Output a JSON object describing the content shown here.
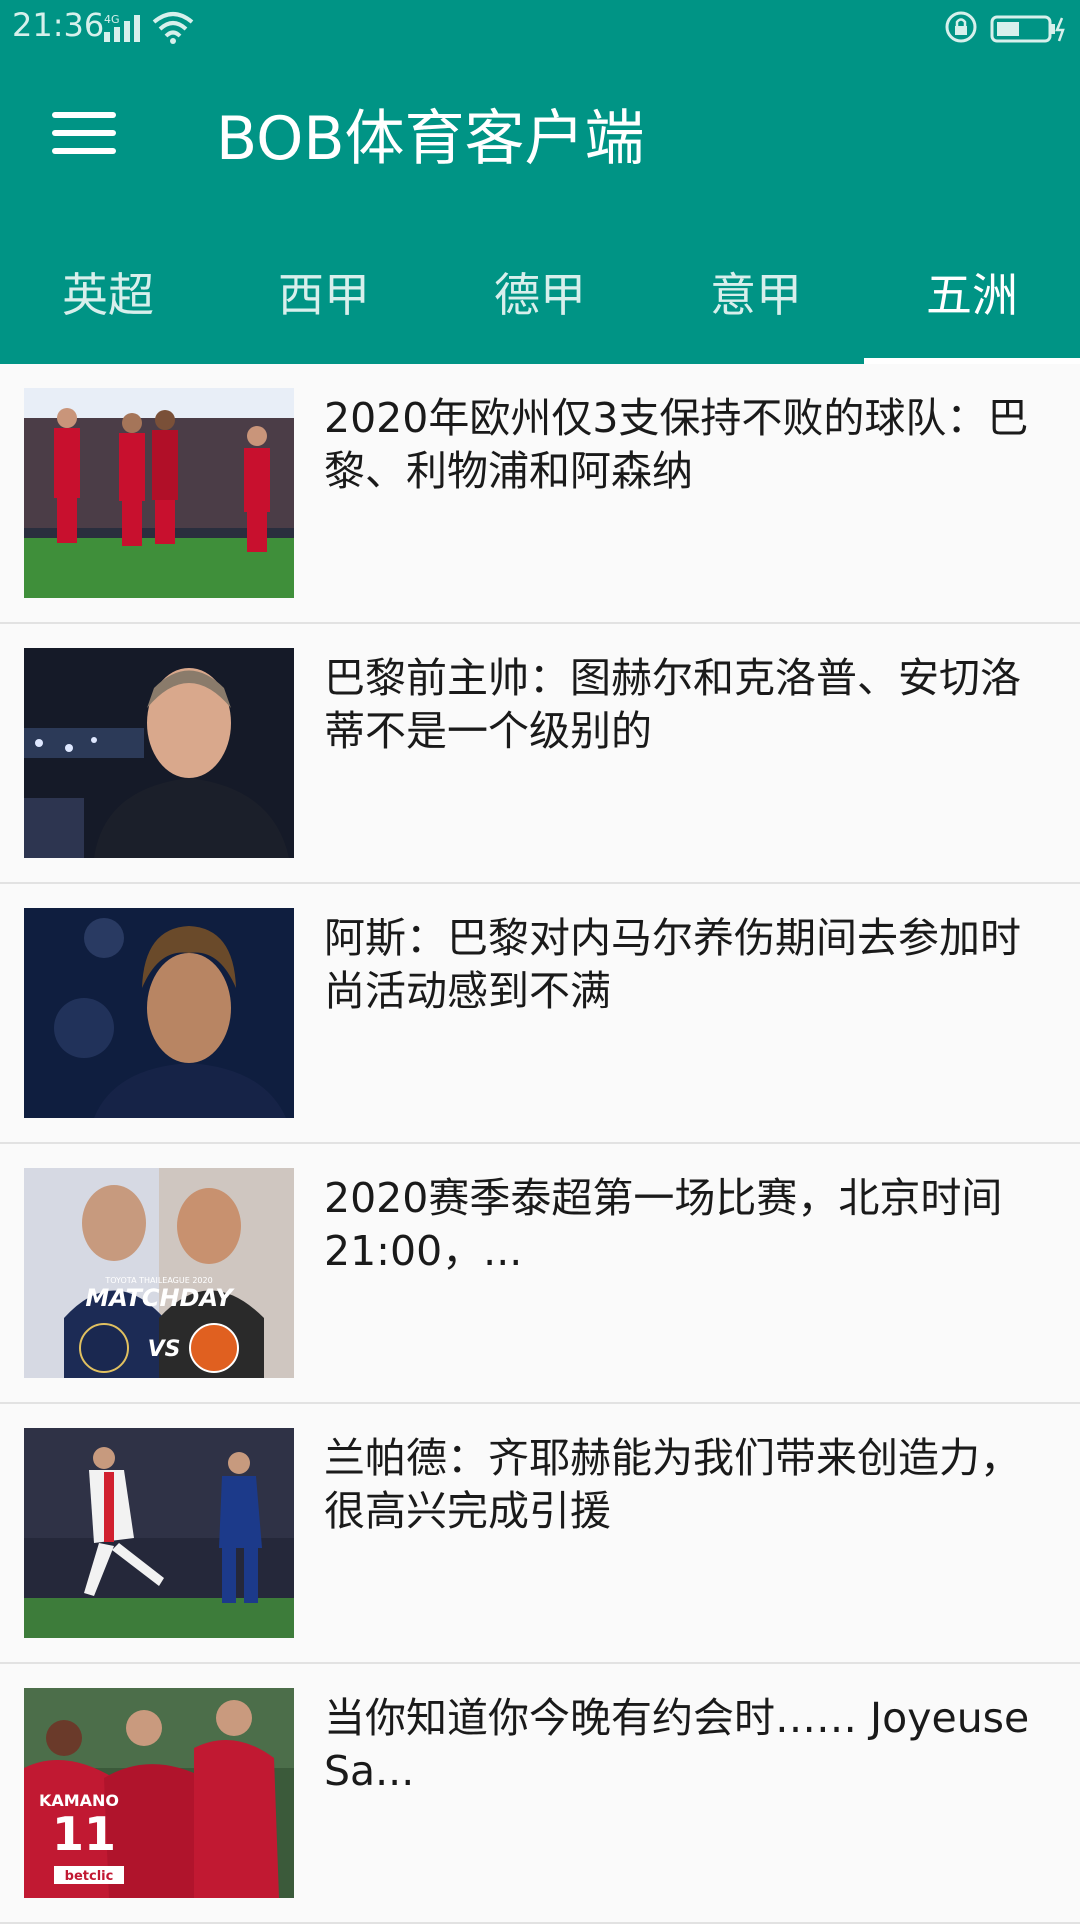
{
  "status": {
    "time": "21:36",
    "network": "4G"
  },
  "header": {
    "title": "BOB体育客户端"
  },
  "tabs": [
    {
      "label": "英超"
    },
    {
      "label": "西甲"
    },
    {
      "label": "德甲"
    },
    {
      "label": "意甲"
    },
    {
      "label": "五洲",
      "active": true
    }
  ],
  "articles": [
    {
      "title": "2020年欧州仅3支保持不败的球队：巴黎、利物浦和阿森纳"
    },
    {
      "title": "巴黎前主帅：图赫尔和克洛普、安切洛蒂不是一个级别的"
    },
    {
      "title": "阿斯：巴黎对内马尔养伤期间去参加时尚活动感到不满"
    },
    {
      "title": "2020赛季泰超第一场比赛，北京时间21:00，...",
      "thumb_text_1": "TOYOTA THAILEAGUE 2020",
      "thumb_text_2": "MATCHDAY",
      "thumb_text_3": "VS"
    },
    {
      "title": "兰帕德：齐耶赫能为我们带来创造力，很高兴完成引援"
    },
    {
      "title": "当你知道你今晚有约会时…… Joyeuse Sa...",
      "thumb_text_1": "KAMANO",
      "thumb_text_2": "11",
      "thumb_text_3": "betclic"
    }
  ],
  "colors": {
    "primary": "#009485",
    "text": "#1a1a1a",
    "divider": "#e2e2e2"
  }
}
